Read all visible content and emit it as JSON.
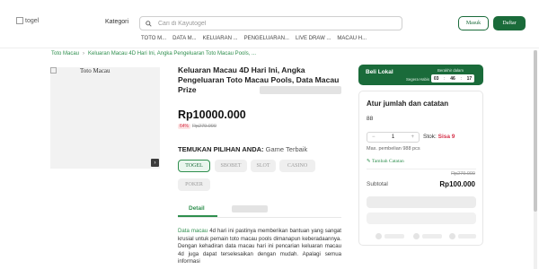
{
  "header": {
    "logo_alt": "togel",
    "kategori_label": "Kategori",
    "search_placeholder": "Cari di Kayutogel",
    "masuk_label": "Masuk",
    "daftar_label": "Daftar",
    "subnav": [
      "TOTO M...",
      "DATA M...",
      "KELUARAN ...",
      "PENGELUARAN...",
      "LIVE DRAW ...",
      "MACAU H..."
    ]
  },
  "breadcrumb": {
    "home": "Toto Macau",
    "current": "Keluaran Macau 4D Hari Ini, Angka Pengeluaran Toto Macau Pools, ..."
  },
  "product": {
    "image_alt": "Toto Macau",
    "title": "Keluaran Macau 4D Hari Ini, Angka Pengeluaran Toto Macau Pools, Data Macau Prize",
    "price": "Rp10000.000",
    "discount": "64%",
    "old_price": "Rp279.000",
    "temukan_label": "TEMUKAN PILIHAN ANDA:",
    "temukan_value": "Game Terbaik",
    "options": [
      "TOGEL",
      "SBOBET",
      "SLOT",
      "CASINO",
      "POKER"
    ],
    "selected_option": "TOGEL",
    "tab_detail": "Detail",
    "description_link": "Data macau",
    "description": "4d hari ini pastinya memberikan bantuan yang sangat krusial untuk pemain toto macau pools dimanapun keberadaannya. Dengan kehadiran data macau hari ini pencarian keluaran macau 4d juga dapat terselesaikan dengan mudah. Apalagi semua informasi"
  },
  "beli_lokal": {
    "label": "Beli Lokal",
    "sub_left": "Segera Habis",
    "sub_right": "Berakhir dalam",
    "hours": "03",
    "minutes": "46",
    "seconds": "17"
  },
  "order_card": {
    "heading": "Atur jumlah dan catatan",
    "variant": "88",
    "quantity": "1",
    "minus": "−",
    "plus": "+",
    "stok_label": "Stok:",
    "sisa": "Sisa 9",
    "maks": "Max. pembelian 988 pcs",
    "catatan": "Tambah Catatan",
    "old_price": "Rp279.000",
    "subtotal_label": "Subtotal",
    "subtotal_value": "Rp100.000"
  },
  "colors": {
    "brand_green": "#1a6b3a",
    "accent_green": "#2f8f4e",
    "discount_red": "#d6324a"
  }
}
